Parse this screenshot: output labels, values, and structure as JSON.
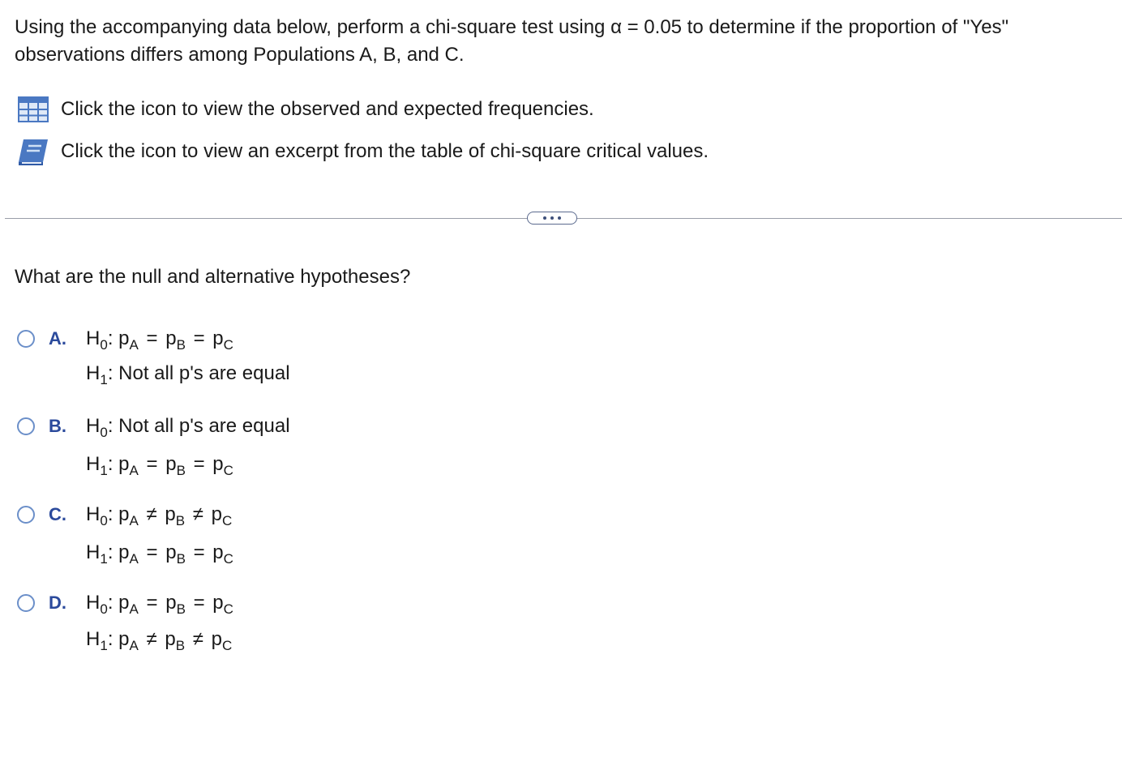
{
  "intro_text": "Using the accompanying data below, perform a chi-square test using α = 0.05 to determine if the proportion of \"Yes\" observations differs among Populations A, B, and C.",
  "resources": [
    {
      "icon": "table-grid-icon",
      "label": "Click the icon to view the observed and expected frequencies."
    },
    {
      "icon": "book-icon",
      "label": "Click the icon to view an excerpt from the table of chi-square critical values."
    }
  ],
  "question": "What are the null and alternative hypotheses?",
  "symbols": {
    "h": "H",
    "sub0": "0",
    "sub1": "1",
    "colon": ":",
    "p": "p",
    "subA": "A",
    "subB": "B",
    "subC": "C",
    "eq": "=",
    "neq": "≠"
  },
  "options": [
    {
      "letter": "A.",
      "h0": "pA = pB = pC",
      "h1": "Not all p's are equal"
    },
    {
      "letter": "B.",
      "h0": "Not all p's are equal",
      "h1": "pA = pB = pC"
    },
    {
      "letter": "C.",
      "h0": "pA ≠ pB ≠ pC",
      "h1": "pA = pB = pC"
    },
    {
      "letter": "D.",
      "h0": "pA = pB = pC",
      "h1": "pA ≠ pB ≠ pC"
    }
  ],
  "colors": {
    "accent": "#2b4a9c",
    "radio_border": "#6b8fc9",
    "divider": "#9a9ea8"
  }
}
